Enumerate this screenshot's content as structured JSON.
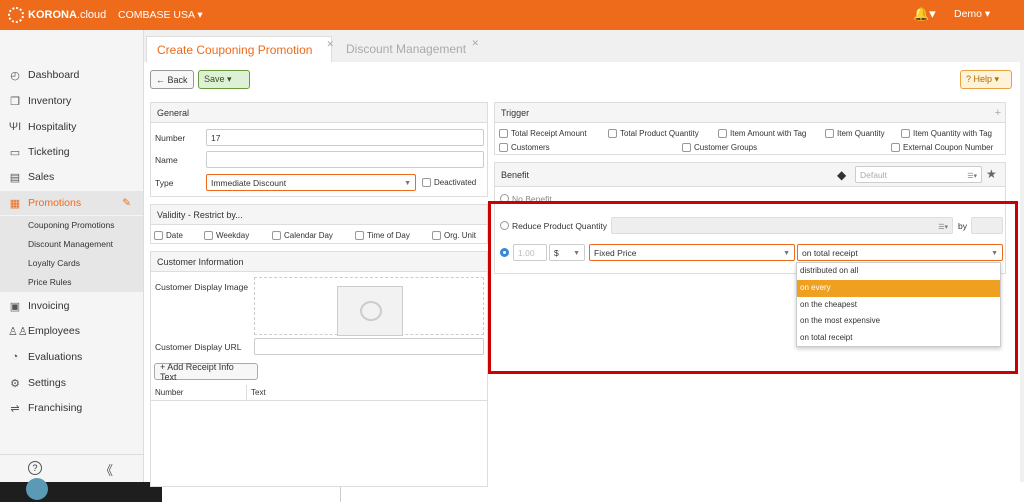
{
  "app": {
    "brand": "KORONA",
    "brand_suffix": ".cloud",
    "org": "COMBASE USA ▾",
    "user": "Demo ▾",
    "bell": "🔔▾"
  },
  "sidebar": {
    "items": [
      {
        "label": "Dashboard",
        "icon": "dashboard-icon",
        "glyph": "◴"
      },
      {
        "label": "Inventory",
        "icon": "inventory-icon",
        "glyph": "❐"
      },
      {
        "label": "Hospitality",
        "icon": "hospitality-icon",
        "glyph": "ΨΙ"
      },
      {
        "label": "Ticketing",
        "icon": "ticket-icon",
        "glyph": "▭"
      },
      {
        "label": "Sales",
        "icon": "sales-icon",
        "glyph": "▤"
      },
      {
        "label": "Promotions",
        "icon": "gift-icon",
        "glyph": "▦"
      },
      {
        "label": "Invoicing",
        "icon": "invoice-icon",
        "glyph": "▣"
      },
      {
        "label": "Employees",
        "icon": "employees-icon",
        "glyph": "♙♙"
      },
      {
        "label": "Evaluations",
        "icon": "pie-chart-icon",
        "glyph": "◔"
      },
      {
        "label": "Settings",
        "icon": "gear-icon",
        "glyph": "⚙"
      },
      {
        "label": "Franchising",
        "icon": "handshake-icon",
        "glyph": "⇌"
      }
    ],
    "promotions_sub": [
      "Couponing Promotions",
      "Discount Management",
      "Loyalty Cards",
      "Price Rules"
    ],
    "help_glyph": "?",
    "collapse_glyph": "《"
  },
  "tabs": [
    {
      "label": "Create Couponing Promotion"
    },
    {
      "label": "Discount Management"
    }
  ],
  "toolbar": {
    "back": "← Back",
    "save": "Save ▾",
    "help": "? Help ▾"
  },
  "general": {
    "title": "General",
    "number_label": "Number",
    "number_value": "17",
    "name_label": "Name",
    "name_value": "",
    "type_label": "Type",
    "type_value": "Immediate Discount",
    "deactivated_label": "Deactivated"
  },
  "validity": {
    "title": "Validity - Restrict by...",
    "options": [
      "Date",
      "Weekday",
      "Calendar Day",
      "Time of Day",
      "Org. Unit"
    ]
  },
  "customer_info": {
    "title": "Customer Information",
    "image_label": "Customer Display Image",
    "url_label": "Customer Display URL",
    "add_button": "+ Add Receipt Info Text",
    "columns": [
      "Number",
      "Text"
    ]
  },
  "trigger": {
    "title": "Trigger",
    "add_glyph": "+",
    "row1": [
      "Total Receipt Amount",
      "Total Product Quantity",
      "Item Amount with Tag",
      "Item Quantity",
      "Item Quantity with Tag"
    ],
    "row2": [
      "Customers",
      "Customer Groups",
      "External Coupon Number"
    ]
  },
  "benefit": {
    "title": "Benefit",
    "default_placeholder": "Default",
    "no_benefit": "No Benefit",
    "reduce_qty": "Reduce Product Quantity",
    "by_label": "by",
    "amount_placeholder": "1.00",
    "currency": "$",
    "price_type": "Fixed Price",
    "scope": "on total receipt",
    "scope_options": [
      "distributed on all",
      "on every",
      "on the cheapest",
      "on the most expensive",
      "on total receipt"
    ],
    "highlighted_option": "on every"
  },
  "colors": {
    "accent": "#ee6b1c",
    "highlight": "#f0a020",
    "annotation": "#cc0000"
  }
}
